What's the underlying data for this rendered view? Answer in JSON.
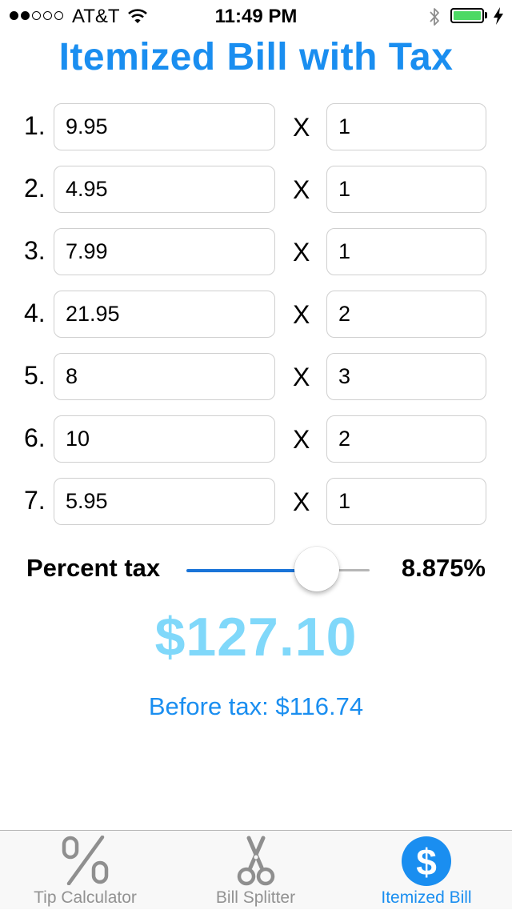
{
  "status_bar": {
    "signal_bars": 2,
    "signal_total": 5,
    "carrier": "AT&T",
    "time": "11:49 PM",
    "battery_level": 1.0,
    "battery_color": "#4cd964"
  },
  "title": "Itemized Bill with Tax",
  "items": [
    {
      "number": "1.",
      "price": "9.95",
      "times": "X",
      "quantity": "1"
    },
    {
      "number": "2.",
      "price": "4.95",
      "times": "X",
      "quantity": "1"
    },
    {
      "number": "3.",
      "price": "7.99",
      "times": "X",
      "quantity": "1"
    },
    {
      "number": "4.",
      "price": "21.95",
      "times": "X",
      "quantity": "2"
    },
    {
      "number": "5.",
      "price": "8",
      "times": "X",
      "quantity": "3"
    },
    {
      "number": "6.",
      "price": "10",
      "times": "X",
      "quantity": "2"
    },
    {
      "number": "7.",
      "price": "5.95",
      "times": "X",
      "quantity": "1"
    }
  ],
  "tax": {
    "label": "Percent tax",
    "value": "8.875%",
    "slider_fraction": 0.7
  },
  "total": "$127.10",
  "before_tax": "Before tax: $116.74",
  "tabs": [
    {
      "label": "Tip Calculator",
      "icon": "percent-icon",
      "active": false
    },
    {
      "label": "Bill Splitter",
      "icon": "scissors-icon",
      "active": false
    },
    {
      "label": "Itemized Bill",
      "icon": "dollar-circle-icon",
      "active": true
    }
  ],
  "colors": {
    "accent": "#1a8ef0",
    "total": "#80d8fa",
    "inactive_tab": "#929292"
  }
}
